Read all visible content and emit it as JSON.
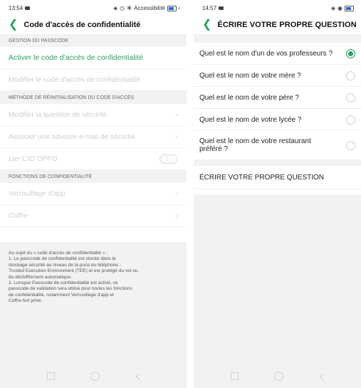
{
  "left": {
    "status": {
      "time": "13:54",
      "right_text": "Accessibilité"
    },
    "title": "Code d'accès de confidentialité",
    "sections": [
      {
        "header": "GESTION DU PASSCODE",
        "items": [
          {
            "label": "Activer le code d'accès de confidentialité",
            "state": "active"
          },
          {
            "label": "Modifier le code d'accès de confidentialité",
            "state": "disabled"
          }
        ]
      },
      {
        "header": "MÉTHODE DE RÉINITIALISATION DU CODE D'ACCÈS",
        "items": [
          {
            "label": "Modifier la question de sécurité",
            "state": "disabled"
          },
          {
            "label": "Associer une adresse e-mail de sécurité",
            "state": "disabled"
          },
          {
            "label": "Lier L'ID OPPO",
            "state": "disabled"
          }
        ]
      },
      {
        "header": "FONCTIONS DE CONFIDENTIALITÉ",
        "items": [
          {
            "label": "Verrouillage d'app",
            "state": "disabled"
          },
          {
            "label": "Coffre",
            "state": "disabled"
          }
        ]
      }
    ],
    "info_lines": [
      "Au sujet du « code d'accès de confidentialité » :",
      "1. Le passcode de confidentialité est stocké dans le",
      "stockage sécurité au niveau de la puce du téléphone -",
      "Trusted Execution Environment (TEE) et est protégé du vol ou",
      "du déchiffrement automatique.",
      "2. Lorsque Passcode de confidentialité est activé, ce",
      "passcode de validation sera utilisé pour toutes les fonctions",
      "de confidentialité, notamment Verrouillage d'app et",
      "Coffre-fort privé."
    ]
  },
  "right": {
    "status": {
      "time": "14:57"
    },
    "title": "ÉCRIRE VOTRE PROPRE QUESTION",
    "questions": [
      {
        "label": "Quel est le nom d'un de vos professeurs ?",
        "selected": true
      },
      {
        "label": "Quel est le nom de votre mère ?",
        "selected": false
      },
      {
        "label": "Quel est le nom de votre père ?",
        "selected": false
      },
      {
        "label": "Quel est le nom de votre lycée ?",
        "selected": false
      },
      {
        "label": "Quel est le nom de votre restaurant préféré ?",
        "selected": false
      }
    ],
    "write_own": "ÉCRIRE VOTRE PROPRE QUESTION"
  },
  "colors": {
    "accent": "#2aa35f",
    "section_bg": "#f2f2f2",
    "disabled_text": "#cfcfcf"
  }
}
